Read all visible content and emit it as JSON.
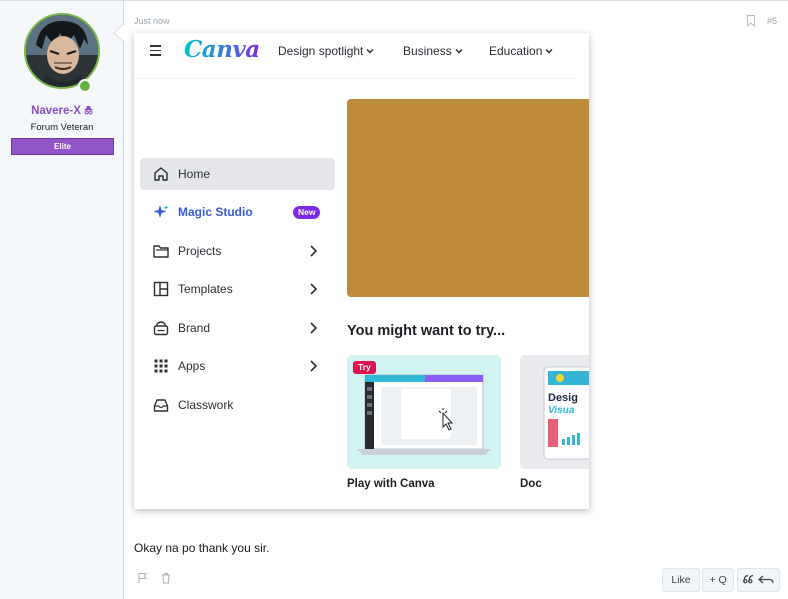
{
  "user": {
    "name": "Navere-X",
    "title": "Forum Veteran",
    "banner": "Elite",
    "name_color": "#8a4fc7",
    "banner_color": "#9354c9"
  },
  "post": {
    "time": "Just now",
    "number": "#5",
    "text": "Okay na po thank you sir."
  },
  "canva": {
    "logo": "Canva",
    "nav": [
      "Design spotlight",
      "Business",
      "Education"
    ],
    "sidebar": [
      {
        "label": "Home",
        "icon": "home-icon"
      },
      {
        "label": "Magic Studio",
        "icon": "sparkle-icon",
        "badge": "New"
      },
      {
        "label": "Projects",
        "icon": "folder-icon"
      },
      {
        "label": "Templates",
        "icon": "template-icon"
      },
      {
        "label": "Brand",
        "icon": "brand-icon"
      },
      {
        "label": "Apps",
        "icon": "apps-icon"
      },
      {
        "label": "Classwork",
        "icon": "inbox-icon"
      }
    ],
    "section_title": "You might want to try...",
    "cards": [
      {
        "title": "Play with Canva",
        "badge": "Try"
      },
      {
        "title": "Doc",
        "preview_text": "Desig",
        "preview_subtext": "Visua"
      }
    ],
    "colors": {
      "hero": "#be8b3a",
      "card1_bg": "#d1f3f2",
      "magic_blue": "#3d5ad6",
      "new_badge": "#7d2ae8",
      "try_badge": "#e0124f"
    }
  },
  "actions": {
    "like": "Like",
    "quote": "+ Q"
  }
}
